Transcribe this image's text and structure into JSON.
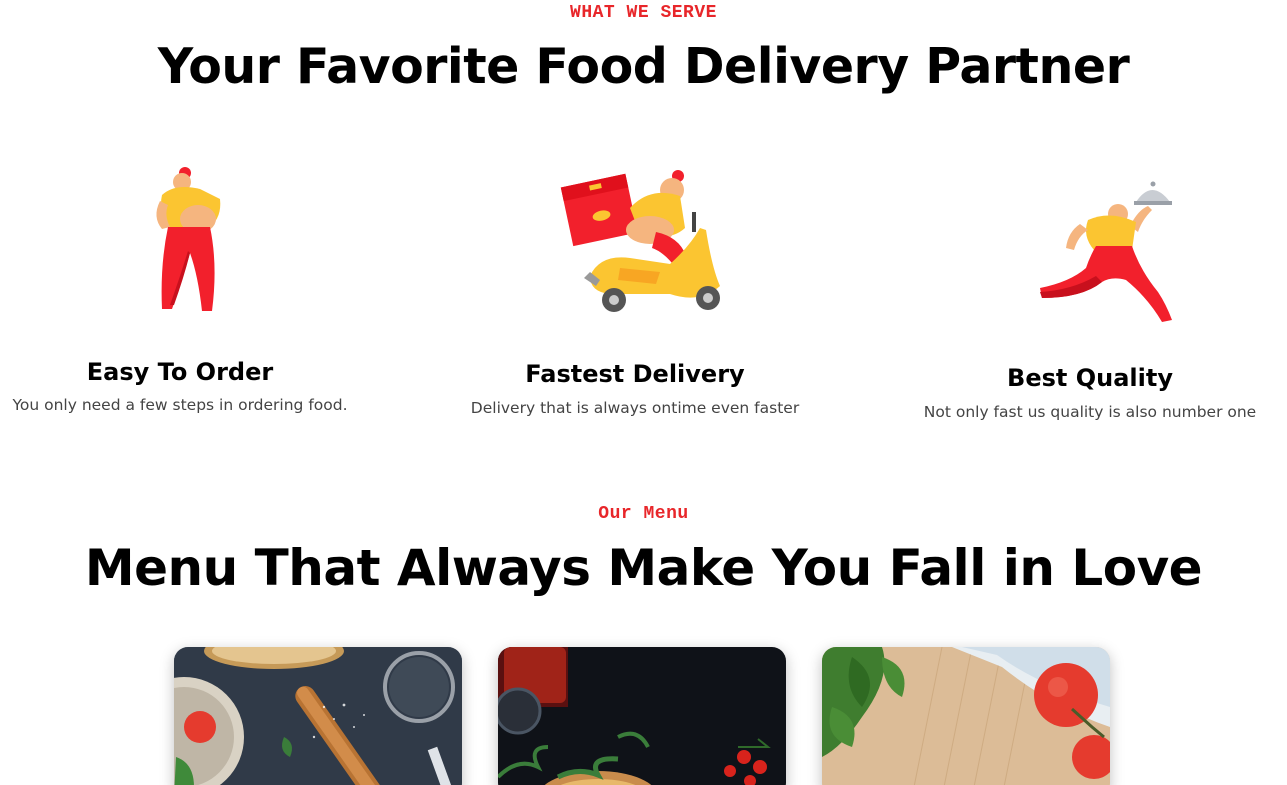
{
  "serve": {
    "eyebrow": "WHAT WE SERVE",
    "title": "Your Favorite Food Delivery Partner",
    "features": [
      {
        "title": "Easy To Order",
        "description": "You only need a few steps in ordering food.",
        "icon": "courier-carrying-box-icon"
      },
      {
        "title": "Fastest Delivery",
        "description": "Delivery that is always ontime even faster",
        "icon": "scooter-delivery-icon"
      },
      {
        "title": "Best Quality",
        "description": "Not only fast us quality is also number one",
        "icon": "running-waiter-cloche-icon"
      }
    ]
  },
  "menu": {
    "eyebrow": "Our Menu",
    "title": "Menu That Always Make You Fall in Love",
    "cards": [
      {
        "image": "pizza-dough-preparation-photo"
      },
      {
        "image": "pizza-with-arugula-photo"
      },
      {
        "image": "tomatoes-basil-on-cutting-board-photo"
      }
    ]
  },
  "colors": {
    "accent": "#e8262a",
    "illustration_red": "#f2202c",
    "illustration_yellow": "#fbc531"
  }
}
